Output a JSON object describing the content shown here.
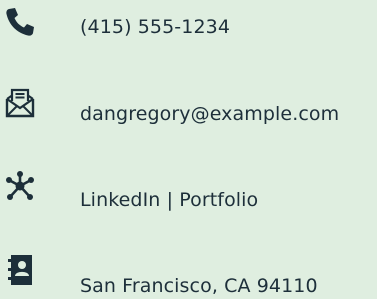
{
  "contacts": {
    "phone": {
      "icon": "phone-icon",
      "text": "(415) 555-1234"
    },
    "email": {
      "icon": "mail-letter-icon",
      "text": "dangregory@example.com"
    },
    "links": {
      "icon": "network-hub-icon",
      "text": "LinkedIn | Portfolio"
    },
    "address": {
      "icon": "contact-card-icon",
      "text": "San Francisco, CA 94110"
    }
  },
  "colors": {
    "background": "#dfeee0",
    "text": "#1d2f3a",
    "icon": "#1d2f3a"
  }
}
